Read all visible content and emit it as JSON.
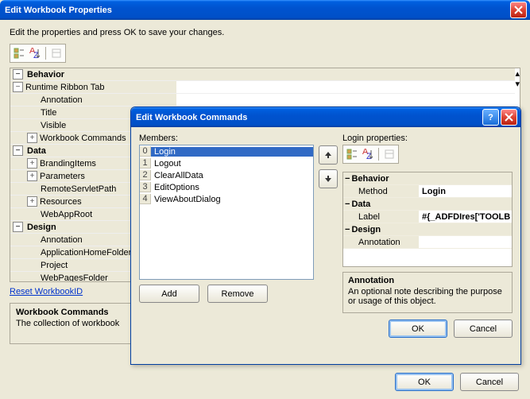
{
  "window": {
    "title": "Edit Workbook Properties",
    "instruction": "Edit the properties and press OK to save your changes.",
    "reset_link": "Reset WorkbookID",
    "ok_label": "OK",
    "cancel_label": "Cancel"
  },
  "toolbar": {
    "categorized_tip": "Categorized",
    "alphabetical_tip": "Alphabetical",
    "pages_tip": "Property Pages"
  },
  "propgrid": {
    "cat_behavior": "Behavior",
    "behavior": {
      "runtime_ribbon_tab": "Runtime Ribbon Tab",
      "annotation": "Annotation",
      "title": "Title",
      "visible": "Visible",
      "workbook_commands": "Workbook Commands"
    },
    "cat_data": "Data",
    "data": {
      "branding_items": "BrandingItems",
      "parameters": "Parameters",
      "remote_servlet_path": "RemoteServletPath",
      "resources": "Resources",
      "web_app_root": "WebAppRoot"
    },
    "cat_design": "Design",
    "design": {
      "annotation": "Annotation",
      "application_home_folder": "ApplicationHomeFolder",
      "project": "Project",
      "web_pages_folder": "WebPagesFolder"
    }
  },
  "desc": {
    "title": "Workbook Commands",
    "text": "The collection of workbook"
  },
  "modal": {
    "title": "Edit Workbook Commands",
    "members_label": "Members:",
    "props_label": "Login properties:",
    "members": [
      {
        "idx": "0",
        "label": "Login"
      },
      {
        "idx": "1",
        "label": "Logout"
      },
      {
        "idx": "2",
        "label": "ClearAllData"
      },
      {
        "idx": "3",
        "label": "EditOptions"
      },
      {
        "idx": "4",
        "label": "ViewAboutDialog"
      }
    ],
    "add_label": "Add",
    "remove_label": "Remove",
    "up_tip": "Move Up",
    "down_tip": "Move Down",
    "grid": {
      "cat_behavior": "Behavior",
      "method_label": "Method",
      "method_value": "Login",
      "cat_data": "Data",
      "label_label": "Label",
      "label_value": "#{_ADFDIres['TOOLB",
      "cat_design": "Design",
      "annotation_label": "Annotation",
      "annotation_value": ""
    },
    "desc": {
      "title": "Annotation",
      "text": "An optional note describing the purpose or usage of this object."
    },
    "ok_label": "OK",
    "cancel_label": "Cancel"
  },
  "chart_data": null
}
